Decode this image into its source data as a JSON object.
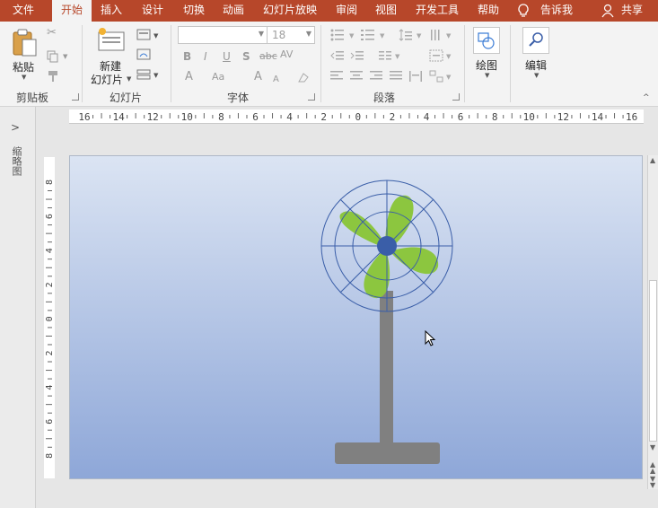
{
  "tabs": [
    {
      "label": "文件",
      "active": false
    },
    {
      "label": "开始",
      "active": true
    },
    {
      "label": "插入",
      "active": false
    },
    {
      "label": "设计",
      "active": false
    },
    {
      "label": "切换",
      "active": false
    },
    {
      "label": "动画",
      "active": false
    },
    {
      "label": "幻灯片放映",
      "active": false
    },
    {
      "label": "审阅",
      "active": false
    },
    {
      "label": "视图",
      "active": false
    },
    {
      "label": "开发工具",
      "active": false
    },
    {
      "label": "帮助",
      "active": false
    }
  ],
  "tell_me": "告诉我",
  "share": "共享",
  "ribbon": {
    "clipboard": {
      "label": "剪贴板",
      "paste": "粘贴"
    },
    "slides": {
      "label": "幻灯片",
      "new_slide_line1": "新建",
      "new_slide_line2": "幻灯片"
    },
    "font": {
      "label": "字体",
      "size": "18"
    },
    "paragraph": {
      "label": "段落"
    },
    "drawing": {
      "label": "绘图"
    },
    "editing": {
      "label": "编辑"
    }
  },
  "thumbnail_panel": {
    "label": "缩略图"
  },
  "ruler": {
    "horizontal": [
      "16",
      "14",
      "12",
      "10",
      "8",
      "6",
      "4",
      "2",
      "0",
      "2",
      "4",
      "6",
      "8",
      "10",
      "12",
      "14",
      "16"
    ],
    "vertical": [
      "8",
      "6",
      "4",
      "2",
      "0",
      "2",
      "4",
      "6",
      "8"
    ]
  },
  "colors": {
    "accent": "#b7472a",
    "fan_blade": "#8cc63f",
    "fan_hub": "#3a5ea8",
    "stand": "#808080"
  }
}
